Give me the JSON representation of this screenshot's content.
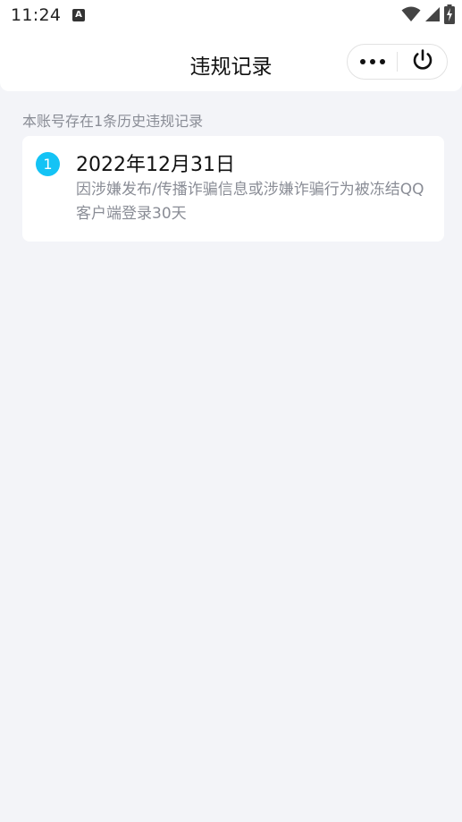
{
  "status_bar": {
    "time": "11:24",
    "app_icon": "A",
    "icons": [
      "wifi-icon",
      "cell-signal-icon",
      "battery-charging-icon"
    ]
  },
  "header": {
    "title": "违规记录",
    "more_icon": "more-dots-icon",
    "close_icon": "power-icon"
  },
  "summary": "本账号存在1条历史违规记录",
  "records": [
    {
      "index": "1",
      "date": "2022年12月31日",
      "description": "因涉嫌发布/传播诈骗信息或涉嫌诈骗行为被冻结QQ客户端登录30天"
    }
  ],
  "colors": {
    "background": "#f3f4f8",
    "accent": "#14c3f5",
    "secondary_text": "#8a8d96"
  }
}
